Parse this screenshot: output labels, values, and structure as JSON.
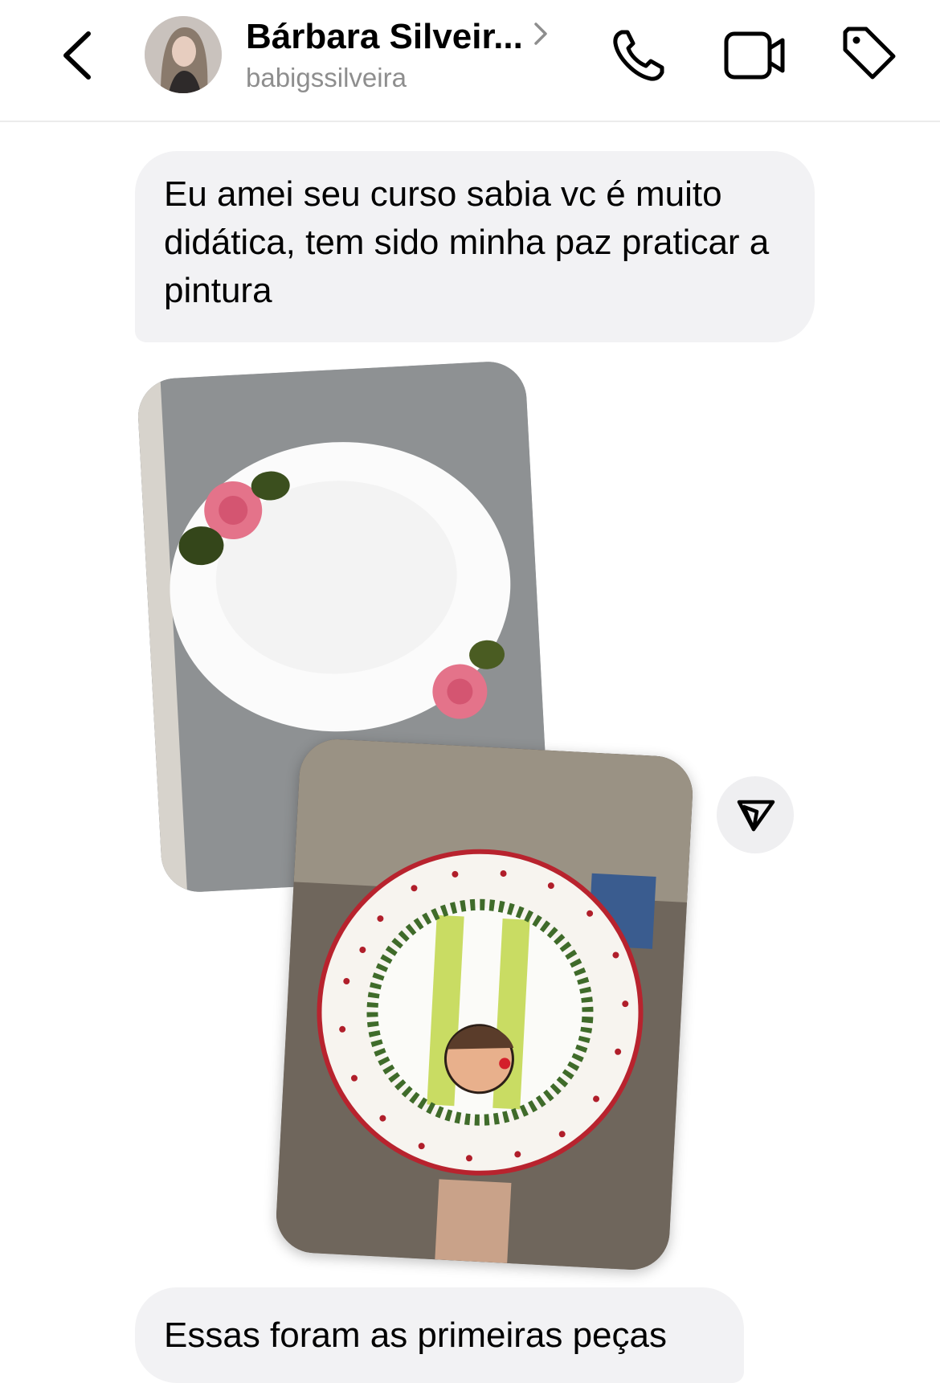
{
  "header": {
    "contact_name": "Bárbara Silveir...",
    "username": "babigssilveira",
    "icons": {
      "back": "chevron-left-icon",
      "profile": "chevron-right-icon",
      "call": "phone-icon",
      "video": "video-camera-icon",
      "tag": "tag-icon"
    }
  },
  "messages": [
    {
      "type": "text",
      "text": "Eu amei seu curso sabia vc é muito didática, tem sido minha paz praticar a pintura"
    },
    {
      "type": "photo",
      "description_icon": "photo-plate-roses"
    },
    {
      "type": "photo",
      "description_icon": "photo-plate-reindeer"
    },
    {
      "type": "text",
      "text": "Essas foram as primeiras peças"
    }
  ],
  "share": {
    "icon": "paper-plane-icon"
  },
  "colors": {
    "bubble_bg": "#f2f2f4",
    "secondary_text": "#8e8e8e",
    "divider": "#ececec"
  }
}
